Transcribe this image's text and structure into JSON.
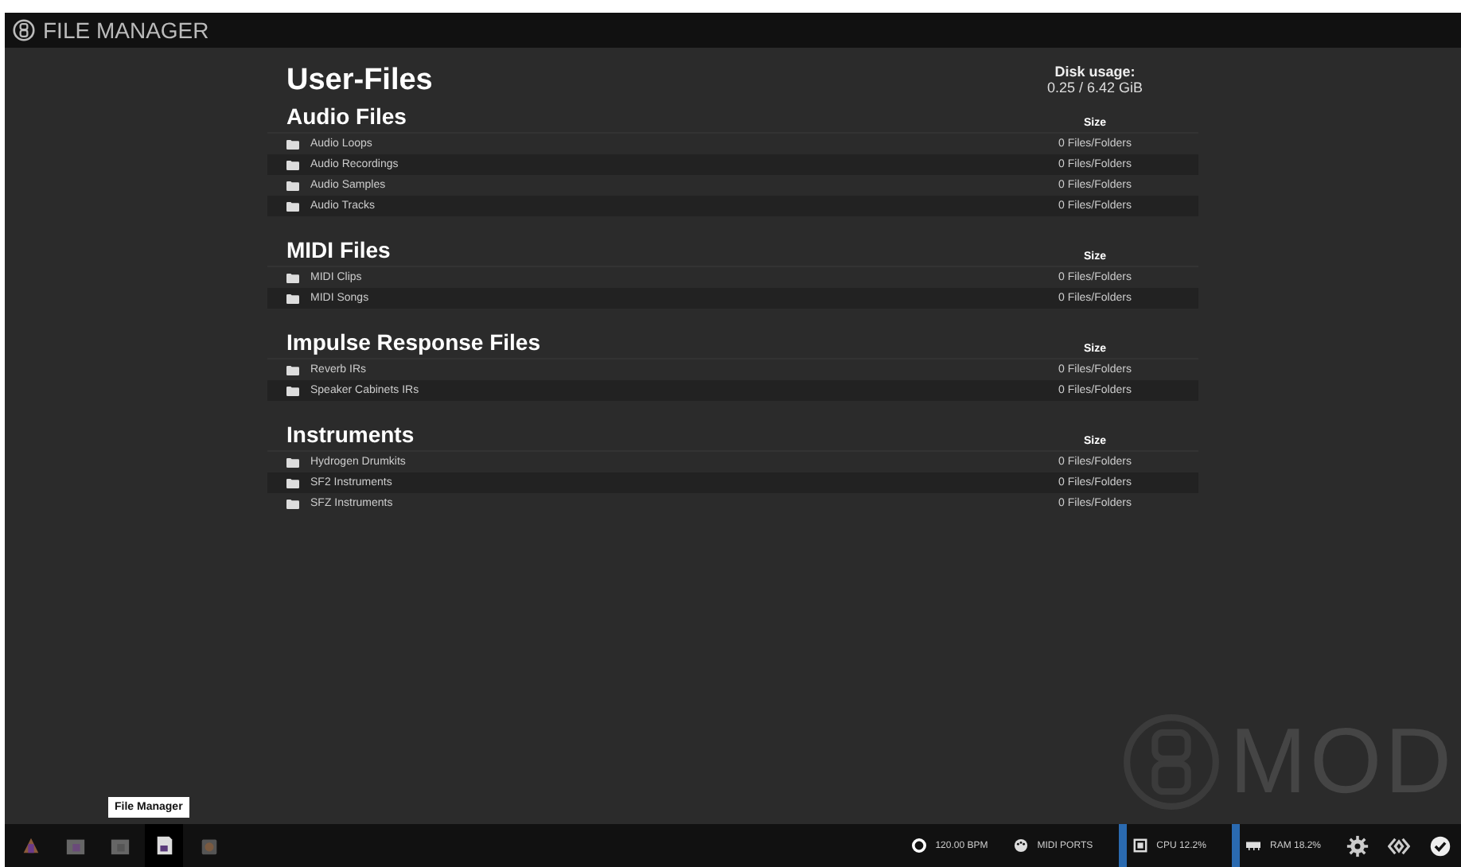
{
  "window": {
    "title": "FILE MANAGER"
  },
  "page_title": "User-Files",
  "disk_usage": {
    "label": "Disk usage:",
    "value": "0.25 / 6.42 GiB"
  },
  "sections": [
    {
      "title": "Audio Files",
      "size_header": "Size",
      "folders": [
        {
          "name": "Audio Loops",
          "size": "0 Files/Folders"
        },
        {
          "name": "Audio Recordings",
          "size": "0 Files/Folders"
        },
        {
          "name": "Audio Samples",
          "size": "0 Files/Folders"
        },
        {
          "name": "Audio Tracks",
          "size": "0 Files/Folders"
        }
      ]
    },
    {
      "title": "MIDI Files",
      "size_header": "Size",
      "folders": [
        {
          "name": "MIDI Clips",
          "size": "0 Files/Folders"
        },
        {
          "name": "MIDI Songs",
          "size": "0 Files/Folders"
        }
      ]
    },
    {
      "title": "Impulse Response Files",
      "size_header": "Size",
      "folders": [
        {
          "name": "Reverb IRs",
          "size": "0 Files/Folders"
        },
        {
          "name": "Speaker Cabinets IRs",
          "size": "0 Files/Folders"
        }
      ]
    },
    {
      "title": "Instruments",
      "size_header": "Size",
      "folders": [
        {
          "name": "Hydrogen Drumkits",
          "size": "0 Files/Folders"
        },
        {
          "name": "SF2 Instruments",
          "size": "0 Files/Folders"
        },
        {
          "name": "SFZ Instruments",
          "size": "0 Files/Folders"
        }
      ]
    }
  ],
  "logo_text": "MOD",
  "taskbar": {
    "tooltip": "File Manager",
    "apps": [
      {
        "kind": "pedalboard",
        "selected": false
      },
      {
        "kind": "bank",
        "selected": false
      },
      {
        "kind": "library",
        "selected": false
      },
      {
        "kind": "files",
        "selected": true
      },
      {
        "kind": "store",
        "selected": false
      }
    ]
  },
  "status": [
    {
      "kind": "bpm",
      "text": "120.00 BPM"
    },
    {
      "kind": "midi",
      "text": "MIDI PORTS"
    },
    {
      "kind": "cpu",
      "text": "CPU 12.2%"
    },
    {
      "kind": "ram",
      "text": "RAM 18.2%"
    }
  ]
}
